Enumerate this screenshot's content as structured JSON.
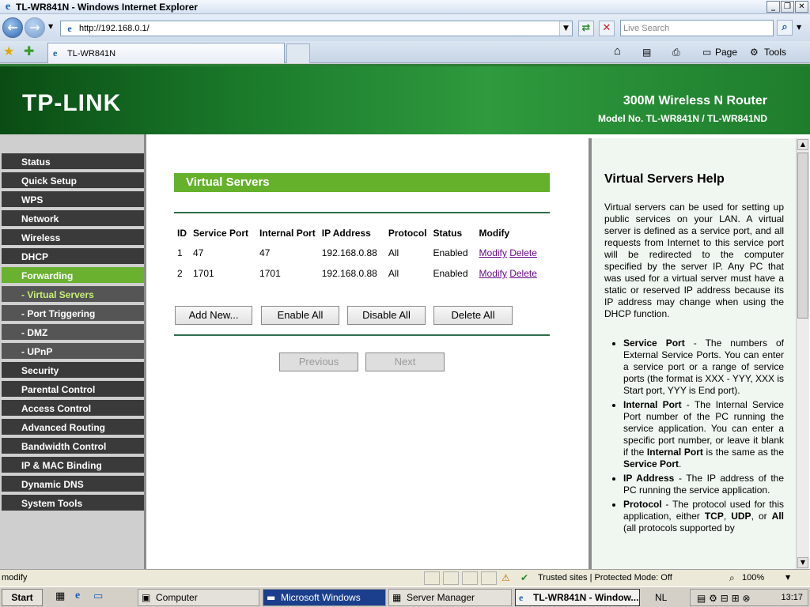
{
  "window": {
    "title": "TL-WR841N - Windows Internet Explorer"
  },
  "browser": {
    "url": "http://192.168.0.1/",
    "search_placeholder": "Live Search",
    "tab_title": "TL-WR841N",
    "commands": {
      "page": "Page",
      "tools": "Tools"
    }
  },
  "banner": {
    "logo": "TP-LINK",
    "product": "300M Wireless N Router",
    "model": "Model No. TL-WR841N / TL-WR841ND"
  },
  "menu": [
    {
      "label": "Status"
    },
    {
      "label": "Quick Setup"
    },
    {
      "label": "WPS"
    },
    {
      "label": "Network"
    },
    {
      "label": "Wireless"
    },
    {
      "label": "DHCP"
    },
    {
      "label": "Forwarding"
    },
    {
      "label": "- Virtual Servers"
    },
    {
      "label": "- Port Triggering"
    },
    {
      "label": "- DMZ"
    },
    {
      "label": "- UPnP"
    },
    {
      "label": "Security"
    },
    {
      "label": "Parental Control"
    },
    {
      "label": "Access Control"
    },
    {
      "label": "Advanced Routing"
    },
    {
      "label": "Bandwidth Control"
    },
    {
      "label": "IP & MAC Binding"
    },
    {
      "label": "Dynamic DNS"
    },
    {
      "label": "System Tools"
    }
  ],
  "main": {
    "title": "Virtual Servers",
    "columns": [
      "ID",
      "Service Port",
      "Internal Port",
      "IP Address",
      "Protocol",
      "Status",
      "Modify"
    ],
    "rows": [
      {
        "id": "1",
        "service_port": "47",
        "internal_port": "47",
        "ip": "192.168.0.88",
        "protocol": "All",
        "status": "Enabled",
        "modify": "Modify",
        "delete": "Delete"
      },
      {
        "id": "2",
        "service_port": "1701",
        "internal_port": "1701",
        "ip": "192.168.0.88",
        "protocol": "All",
        "status": "Enabled",
        "modify": "Modify",
        "delete": "Delete"
      }
    ],
    "buttons": {
      "add_new": "Add New...",
      "enable_all": "Enable All",
      "disable_all": "Disable All",
      "delete_all": "Delete All",
      "previous": "Previous",
      "next": "Next"
    }
  },
  "help": {
    "title": "Virtual Servers Help",
    "intro": "Virtual servers can be used for setting up public services on your LAN. A virtual server is defined as a service port, and all requests from Internet to this service port will be redirected to the computer specified by the server IP. Any PC that was used for a virtual server must have a static or reserved IP address because its IP address may change when using the DHCP function.",
    "items": [
      {
        "term": "Service Port",
        "text": " - The numbers of External Service Ports. You can enter a service port or a range of service ports (the format is XXX - YYY, XXX is Start port, YYY is End port)."
      },
      {
        "term": "Internal Port",
        "text": " - The Internal Service Port number of the PC running the service application. You can enter a specific port number, or leave it blank if the ",
        "term2": "Internal Port",
        "text2": " is the same as the ",
        "term3": "Service Port",
        "text3": "."
      },
      {
        "term": "IP Address",
        "text": " - The IP address of the PC running the service application."
      },
      {
        "term": "Protocol",
        "text": " - The protocol used for this application, either ",
        "term2": "TCP",
        "text2": ", ",
        "term3": "UDP",
        "text3": ", or ",
        "term4": "All",
        "text4": " (all protocols supported by"
      }
    ]
  },
  "statusbar": {
    "text": "modify",
    "zone": "Trusted sites | Protected Mode: Off",
    "zoom": "100%"
  },
  "taskbar": {
    "start": "Start",
    "tasks": [
      "Computer",
      "Microsoft Windows",
      "Server Manager",
      "TL-WR841N - Window..."
    ],
    "language": "NL",
    "clock": "13:17"
  }
}
